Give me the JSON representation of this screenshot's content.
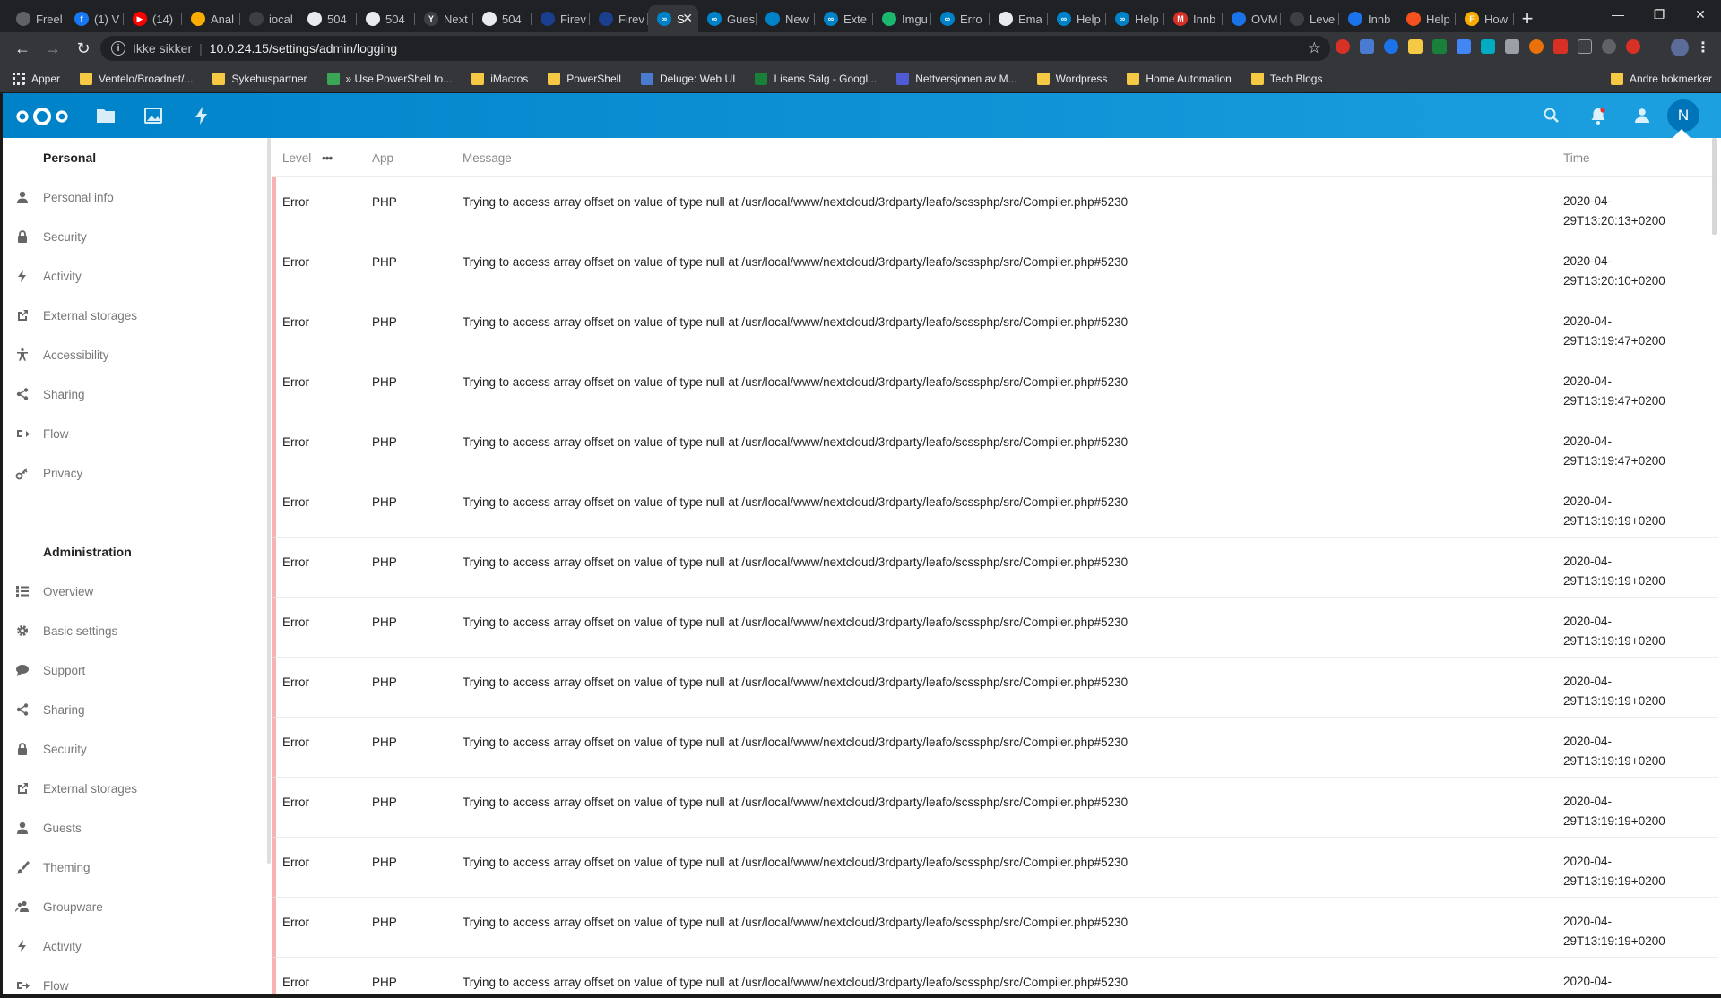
{
  "browser": {
    "tabs": [
      {
        "label": "Freel",
        "color": "#5f6368",
        "glyph": ""
      },
      {
        "label": "(1) V",
        "color": "#1877f2",
        "glyph": "f"
      },
      {
        "label": "(14)",
        "color": "#ff0000",
        "glyph": "▶"
      },
      {
        "label": "Anal",
        "color": "#f9ab00",
        "glyph": ""
      },
      {
        "label": "iocal",
        "color": "#3c4043",
        "glyph": ""
      },
      {
        "label": "504",
        "color": "#e8eaed",
        "glyph": ""
      },
      {
        "label": "504",
        "color": "#e8eaed",
        "glyph": ""
      },
      {
        "label": "Next",
        "color": "#3c4043",
        "glyph": "Y"
      },
      {
        "label": "504",
        "color": "#e8eaed",
        "glyph": ""
      },
      {
        "label": "Firev",
        "color": "#1a3f8f",
        "glyph": ""
      },
      {
        "label": "Firev",
        "color": "#1a3f8f",
        "glyph": ""
      },
      {
        "label": "S",
        "color": "#0082c9",
        "glyph": "∞",
        "active": true
      },
      {
        "label": "Gues",
        "color": "#0082c9",
        "glyph": "∞"
      },
      {
        "label": "New",
        "color": "#0082c9",
        "glyph": ""
      },
      {
        "label": "Exte",
        "color": "#0082c9",
        "glyph": "∞"
      },
      {
        "label": "Imgu",
        "color": "#1bb76e",
        "glyph": ""
      },
      {
        "label": "Erro",
        "color": "#0082c9",
        "glyph": "∞"
      },
      {
        "label": "Ema",
        "color": "#e8eaed",
        "glyph": ""
      },
      {
        "label": "Help",
        "color": "#0082c9",
        "glyph": "∞"
      },
      {
        "label": "Help",
        "color": "#0082c9",
        "glyph": "∞"
      },
      {
        "label": "Innb",
        "color": "#d93025",
        "glyph": "M"
      },
      {
        "label": "OVM",
        "color": "#1a73e8",
        "glyph": ""
      },
      {
        "label": "Leve",
        "color": "#3c4043",
        "glyph": ""
      },
      {
        "label": "Innb",
        "color": "#1a73e8",
        "glyph": ""
      },
      {
        "label": "Help",
        "color": "#f5511e",
        "glyph": ""
      },
      {
        "label": "How",
        "color": "#f9ab00",
        "glyph": "F"
      }
    ],
    "close_tab_glyph": "✕",
    "new_tab_glyph": "+",
    "window_controls": {
      "minimize": "—",
      "restore": "❐",
      "close": "✕"
    },
    "nav": {
      "back": "←",
      "forward": "→",
      "reload": "↻"
    },
    "address": {
      "security_label": "Ikke sikker",
      "url": "10.0.24.15/settings/admin/logging"
    },
    "bookmarks": [
      {
        "label": "Apper",
        "color": "#e8eaed"
      },
      {
        "label": "Ventelo/Broadnet/...",
        "color": "#f6c945"
      },
      {
        "label": "Sykehuspartner",
        "color": "#f6c945"
      },
      {
        "label": "» Use PowerShell to...",
        "color": "#3aa757"
      },
      {
        "label": "iMacros",
        "color": "#f6c945"
      },
      {
        "label": "PowerShell",
        "color": "#f6c945"
      },
      {
        "label": "Deluge: Web UI",
        "color": "#4a7bd0"
      },
      {
        "label": "Lisens Salg - Googl...",
        "color": "#188038"
      },
      {
        "label": "Nettversjonen av M...",
        "color": "#4f5bd5"
      },
      {
        "label": "Wordpress",
        "color": "#f6c945"
      },
      {
        "label": "Home Automation",
        "color": "#f6c945"
      },
      {
        "label": "Tech Blogs",
        "color": "#f6c945"
      }
    ],
    "other_bookmarks": "Andre bokmerker"
  },
  "nextcloud": {
    "user_initial": "N",
    "accent": "#0082c9",
    "sidebar": {
      "personal_title": "Personal",
      "personal": [
        {
          "label": "Personal info",
          "icon": "user-icon"
        },
        {
          "label": "Security",
          "icon": "lock-icon"
        },
        {
          "label": "Activity",
          "icon": "activity-icon"
        },
        {
          "label": "External storages",
          "icon": "external-icon"
        },
        {
          "label": "Accessibility",
          "icon": "accessibility-icon"
        },
        {
          "label": "Sharing",
          "icon": "share-icon"
        },
        {
          "label": "Flow",
          "icon": "flow-icon"
        },
        {
          "label": "Privacy",
          "icon": "key-icon"
        }
      ],
      "admin_title": "Administration",
      "admin": [
        {
          "label": "Overview",
          "icon": "list-icon"
        },
        {
          "label": "Basic settings",
          "icon": "gear-icon"
        },
        {
          "label": "Support",
          "icon": "comment-icon"
        },
        {
          "label": "Sharing",
          "icon": "share-icon"
        },
        {
          "label": "Security",
          "icon": "lock-icon"
        },
        {
          "label": "External storages",
          "icon": "external-icon"
        },
        {
          "label": "Guests",
          "icon": "user-icon"
        },
        {
          "label": "Theming",
          "icon": "brush-icon"
        },
        {
          "label": "Groupware",
          "icon": "group-icon"
        },
        {
          "label": "Activity",
          "icon": "activity-icon"
        },
        {
          "label": "Flow",
          "icon": "flow-icon"
        }
      ]
    },
    "log": {
      "headers": {
        "level": "Level",
        "level_menu": "•••",
        "app": "App",
        "message": "Message",
        "time": "Time"
      },
      "rows": [
        {
          "level": "Error",
          "app": "PHP",
          "message": "Trying to access array offset on value of type null at /usr/local/www/nextcloud/3rdparty/leafo/scssphp/src/Compiler.php#5230",
          "time_date": "2020-04-",
          "time_clock": "29T13:20:13+0200"
        },
        {
          "level": "Error",
          "app": "PHP",
          "message": "Trying to access array offset on value of type null at /usr/local/www/nextcloud/3rdparty/leafo/scssphp/src/Compiler.php#5230",
          "time_date": "2020-04-",
          "time_clock": "29T13:20:10+0200"
        },
        {
          "level": "Error",
          "app": "PHP",
          "message": "Trying to access array offset on value of type null at /usr/local/www/nextcloud/3rdparty/leafo/scssphp/src/Compiler.php#5230",
          "time_date": "2020-04-",
          "time_clock": "29T13:19:47+0200"
        },
        {
          "level": "Error",
          "app": "PHP",
          "message": "Trying to access array offset on value of type null at /usr/local/www/nextcloud/3rdparty/leafo/scssphp/src/Compiler.php#5230",
          "time_date": "2020-04-",
          "time_clock": "29T13:19:47+0200"
        },
        {
          "level": "Error",
          "app": "PHP",
          "message": "Trying to access array offset on value of type null at /usr/local/www/nextcloud/3rdparty/leafo/scssphp/src/Compiler.php#5230",
          "time_date": "2020-04-",
          "time_clock": "29T13:19:47+0200"
        },
        {
          "level": "Error",
          "app": "PHP",
          "message": "Trying to access array offset on value of type null at /usr/local/www/nextcloud/3rdparty/leafo/scssphp/src/Compiler.php#5230",
          "time_date": "2020-04-",
          "time_clock": "29T13:19:19+0200"
        },
        {
          "level": "Error",
          "app": "PHP",
          "message": "Trying to access array offset on value of type null at /usr/local/www/nextcloud/3rdparty/leafo/scssphp/src/Compiler.php#5230",
          "time_date": "2020-04-",
          "time_clock": "29T13:19:19+0200"
        },
        {
          "level": "Error",
          "app": "PHP",
          "message": "Trying to access array offset on value of type null at /usr/local/www/nextcloud/3rdparty/leafo/scssphp/src/Compiler.php#5230",
          "time_date": "2020-04-",
          "time_clock": "29T13:19:19+0200"
        },
        {
          "level": "Error",
          "app": "PHP",
          "message": "Trying to access array offset on value of type null at /usr/local/www/nextcloud/3rdparty/leafo/scssphp/src/Compiler.php#5230",
          "time_date": "2020-04-",
          "time_clock": "29T13:19:19+0200"
        },
        {
          "level": "Error",
          "app": "PHP",
          "message": "Trying to access array offset on value of type null at /usr/local/www/nextcloud/3rdparty/leafo/scssphp/src/Compiler.php#5230",
          "time_date": "2020-04-",
          "time_clock": "29T13:19:19+0200"
        },
        {
          "level": "Error",
          "app": "PHP",
          "message": "Trying to access array offset on value of type null at /usr/local/www/nextcloud/3rdparty/leafo/scssphp/src/Compiler.php#5230",
          "time_date": "2020-04-",
          "time_clock": "29T13:19:19+0200"
        },
        {
          "level": "Error",
          "app": "PHP",
          "message": "Trying to access array offset on value of type null at /usr/local/www/nextcloud/3rdparty/leafo/scssphp/src/Compiler.php#5230",
          "time_date": "2020-04-",
          "time_clock": "29T13:19:19+0200"
        },
        {
          "level": "Error",
          "app": "PHP",
          "message": "Trying to access array offset on value of type null at /usr/local/www/nextcloud/3rdparty/leafo/scssphp/src/Compiler.php#5230",
          "time_date": "2020-04-",
          "time_clock": "29T13:19:19+0200"
        },
        {
          "level": "Error",
          "app": "PHP",
          "message": "Trying to access array offset on value of type null at /usr/local/www/nextcloud/3rdparty/leafo/scssphp/src/Compiler.php#5230",
          "time_date": "2020-04-",
          "time_clock": ""
        }
      ]
    }
  }
}
